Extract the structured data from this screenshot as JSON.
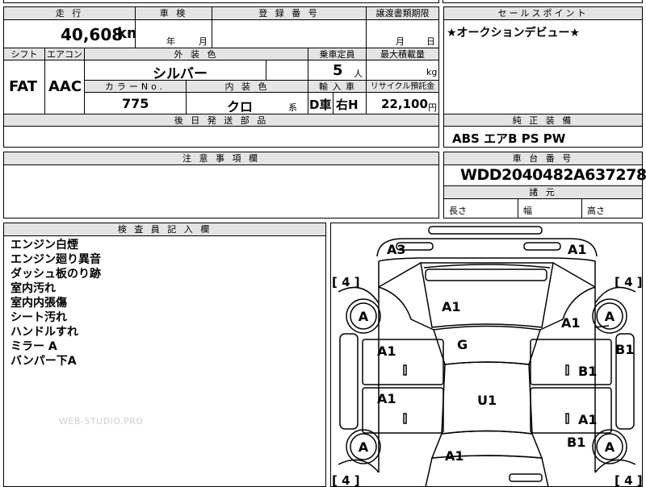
{
  "top": {
    "mileage_header": "走 行",
    "mileage_value": "40,608",
    "mileage_unit": "km",
    "inspection_header": "車 検",
    "year_label": "年",
    "month_label": "月",
    "reg_header": "登 録 番 号",
    "transfer_header": "譲渡書類期限",
    "transfer_month": "月",
    "transfer_day": "日"
  },
  "row2": {
    "shift_header": "シフト",
    "ac_header": "エアコン",
    "color_header": "外 装 色",
    "capacity_header": "乗車定員",
    "load_header": "最大積載量",
    "shift_value": "FAT",
    "ac_value": "AAC",
    "color_value": "シルバー",
    "capacity_value": "5",
    "capacity_unit": "人",
    "load_unit": "kg",
    "color_no_header": "カラーNo.",
    "interior_header": "内 装 色",
    "import_header": "輸 入 車",
    "recycle_header": "リサイクル預託金",
    "color_no_value": "775",
    "interior_value": "クロ",
    "interior_suffix": "系",
    "import_d": "D車",
    "import_h": "右H",
    "recycle_value": "22,100",
    "recycle_unit": "円",
    "parts_header": "後 日 発 送 部 品"
  },
  "sales": {
    "header": "セールスポイント",
    "text": "★オークションデビュー★"
  },
  "equipment": {
    "header": "純 正 装 備",
    "value": "ABS エアB PS PW"
  },
  "caution": {
    "header": "注 意 事 項 欄"
  },
  "chassis": {
    "header": "車 台 番 号",
    "value": "WDD2040482A637278",
    "dims_header": "諸 元",
    "length_label": "長さ",
    "width_label": "幅",
    "height_label": "高さ"
  },
  "inspector": {
    "header": "検 査 員 記 入 欄",
    "notes": [
      "エンジン白煙",
      "エンジン廻り異音",
      "ダッシュ板のり跡",
      "室内汚れ",
      "室内内張傷",
      "シート汚れ",
      "ハンドルすれ",
      "ミラー A",
      "バンパー下A"
    ],
    "watermark": "WEB-STUDIO.PRO"
  },
  "diagram": {
    "marks": {
      "a3_front_left": "A3",
      "a1_front_right": "A1",
      "a1_hood": "A1",
      "a1_fender_right": "A1",
      "g_windshield": "G",
      "a1_door_fl": "A1",
      "b1_door_fr": "B1",
      "b1_mirror_right": "B1",
      "a1_door_rl": "A1",
      "u1_roof": "U1",
      "a1_door_rr": "A1",
      "b1_rear_fender_right": "B1",
      "a1_trunk": "A1"
    },
    "wheels": {
      "fl": "A",
      "fr": "A",
      "rl": "A",
      "rr": "A"
    },
    "tread": {
      "fl": "[ 4 ]",
      "fr": "[ 4 ]",
      "rl": "[ 4 ]",
      "rr": "[ 4 ]"
    }
  }
}
